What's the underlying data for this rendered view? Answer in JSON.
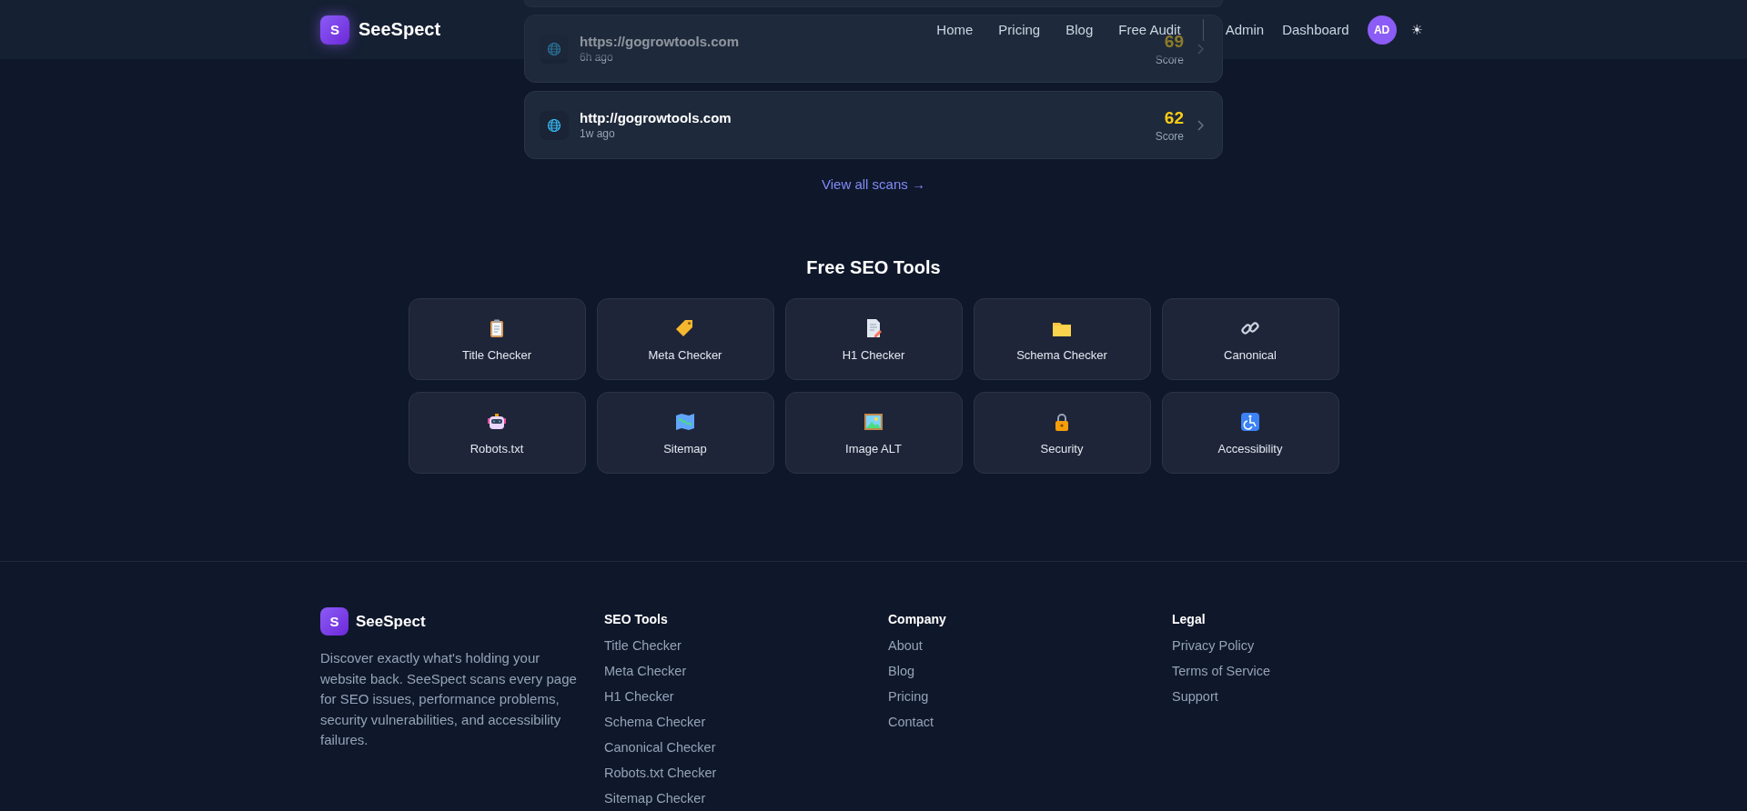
{
  "nav": {
    "logo_letter": "S",
    "brand": "SeeSpect",
    "links": [
      "Home",
      "Pricing",
      "Blog",
      "Free Audit"
    ],
    "account_links": [
      "Admin",
      "Dashboard"
    ],
    "avatar": "AD",
    "theme_toggle": "☀"
  },
  "recent_scans": [
    {
      "url": "https://gogrowtools.com",
      "time": "6h ago",
      "score": "69",
      "score_label": "Score"
    },
    {
      "url": "http://gogrowtools.com",
      "time": "1w ago",
      "score": "62",
      "score_label": "Score"
    }
  ],
  "view_all": "View all scans →",
  "tools_section": {
    "title": "Free SEO Tools",
    "tools": [
      "Title Checker",
      "Meta Checker",
      "H1 Checker",
      "Schema Checker",
      "Canonical",
      "Robots.txt",
      "Sitemap",
      "Image ALT",
      "Security",
      "Accessibility"
    ]
  },
  "footer": {
    "logo_letter": "S",
    "brand": "SeeSpect",
    "description": "Discover exactly what's holding your website back. SeeSpect scans every page for SEO issues, performance problems, security vulnerabilities, and accessibility failures.",
    "columns": [
      {
        "heading": "SEO Tools",
        "links": [
          "Title Checker",
          "Meta Checker",
          "H1 Checker",
          "Schema Checker",
          "Canonical Checker",
          "Robots.txt Checker",
          "Sitemap Checker"
        ]
      },
      {
        "heading": "Company",
        "links": [
          "About",
          "Blog",
          "Pricing",
          "Contact"
        ]
      },
      {
        "heading": "Legal",
        "links": [
          "Privacy Policy",
          "Terms of Service",
          "Support"
        ]
      }
    ]
  }
}
